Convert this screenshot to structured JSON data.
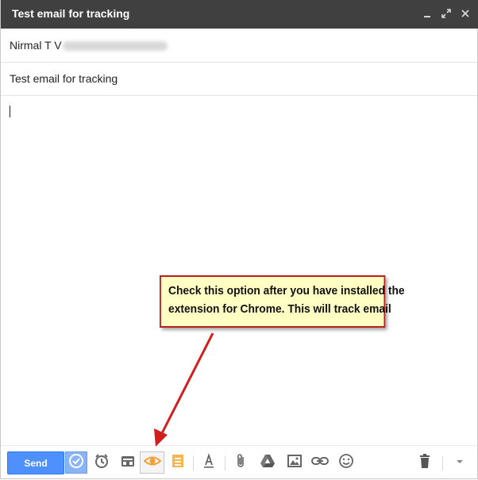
{
  "window": {
    "title": "Test email for tracking"
  },
  "to": {
    "name": "Nirmal T V"
  },
  "subject": {
    "value": "Test email for tracking"
  },
  "toolbar": {
    "send_label": "Send",
    "accent": "#4d90fe",
    "tools": [
      "schedule-icon",
      "alarm-clock-icon",
      "inbox-template-icon",
      "eye-track-icon",
      "notes-icon",
      "formatting-icon",
      "attach-icon",
      "drive-icon",
      "photo-icon",
      "link-icon",
      "emoji-icon",
      "trash-icon",
      "more-options-icon"
    ]
  },
  "annotation": {
    "line1": "Check this option after you have installed the",
    "line2": "extension for Chrome. This will track email",
    "border_color": "#b8201f",
    "fill_color": "#ffffc4"
  }
}
